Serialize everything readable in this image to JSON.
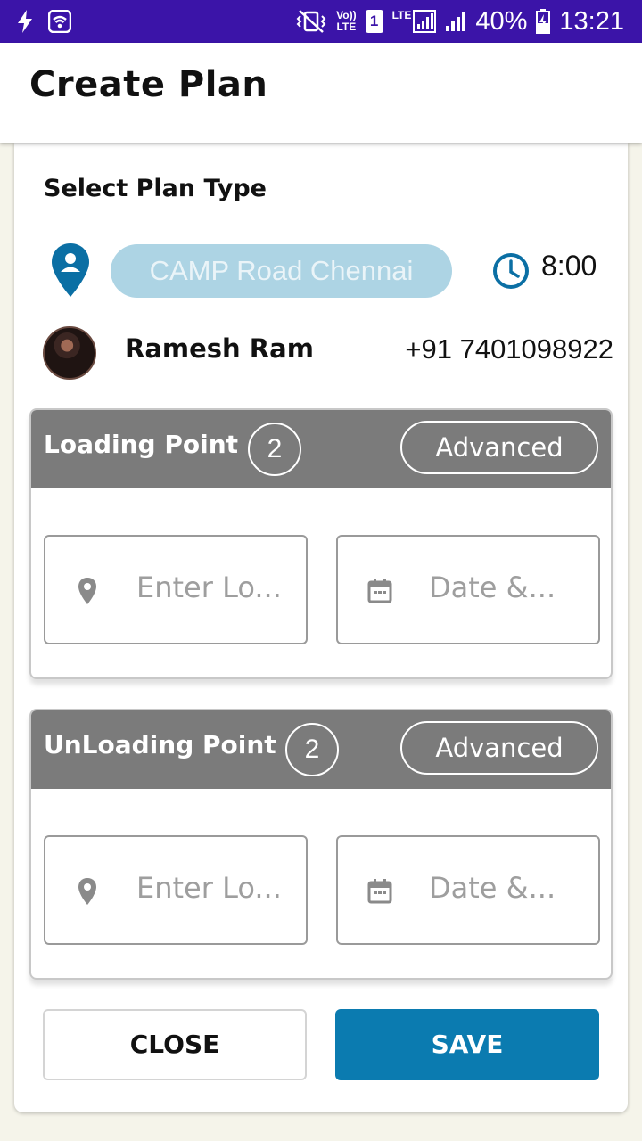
{
  "status_bar": {
    "volte_top": "Vo))",
    "volte_bottom": "LTE",
    "sim_slot": "1",
    "lte_label": "LTE",
    "battery_percent": "40%",
    "time": "13:21"
  },
  "app_bar": {
    "title": "Create Plan"
  },
  "plan": {
    "section_title": "Select Plan Type",
    "location": "CAMP Road Chennai",
    "time": "8:00"
  },
  "driver": {
    "name": "Ramesh Ram",
    "phone": "+91 7401098922"
  },
  "loading": {
    "title": "Loading Point",
    "count": "2",
    "advanced_label": "Advanced",
    "location_placeholder": "Enter Lo...",
    "date_placeholder": "Date &..."
  },
  "unloading": {
    "title": "UnLoading Point",
    "count": "2",
    "advanced_label": "Advanced",
    "location_placeholder": "Enter Lo...",
    "date_placeholder": "Date &..."
  },
  "actions": {
    "close_label": "CLOSE",
    "save_label": "SAVE"
  },
  "colors": {
    "status_bar": "#3b14a8",
    "accent": "#0b7bb0",
    "pill": "#add4e4",
    "section_header": "#7b7b7b"
  }
}
